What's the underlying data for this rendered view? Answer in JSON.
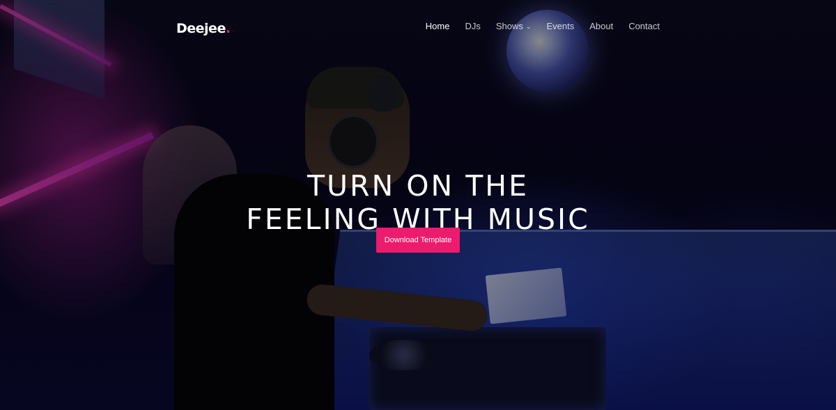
{
  "brand": {
    "name": "Deejee",
    "dot": ".",
    "accent_color": "#ec1b6d"
  },
  "nav": {
    "items": [
      {
        "label": "Home",
        "active": true
      },
      {
        "label": "DJs"
      },
      {
        "label": "Shows",
        "has_dropdown": true,
        "dropdown_icon": "chevron-down-icon"
      },
      {
        "label": "Events"
      },
      {
        "label": "About"
      },
      {
        "label": "Contact"
      }
    ]
  },
  "hero": {
    "headline_line1": "TURN ON THE",
    "headline_line2": "FEELING WITH MUSIC",
    "cta_label": "Download Template"
  }
}
